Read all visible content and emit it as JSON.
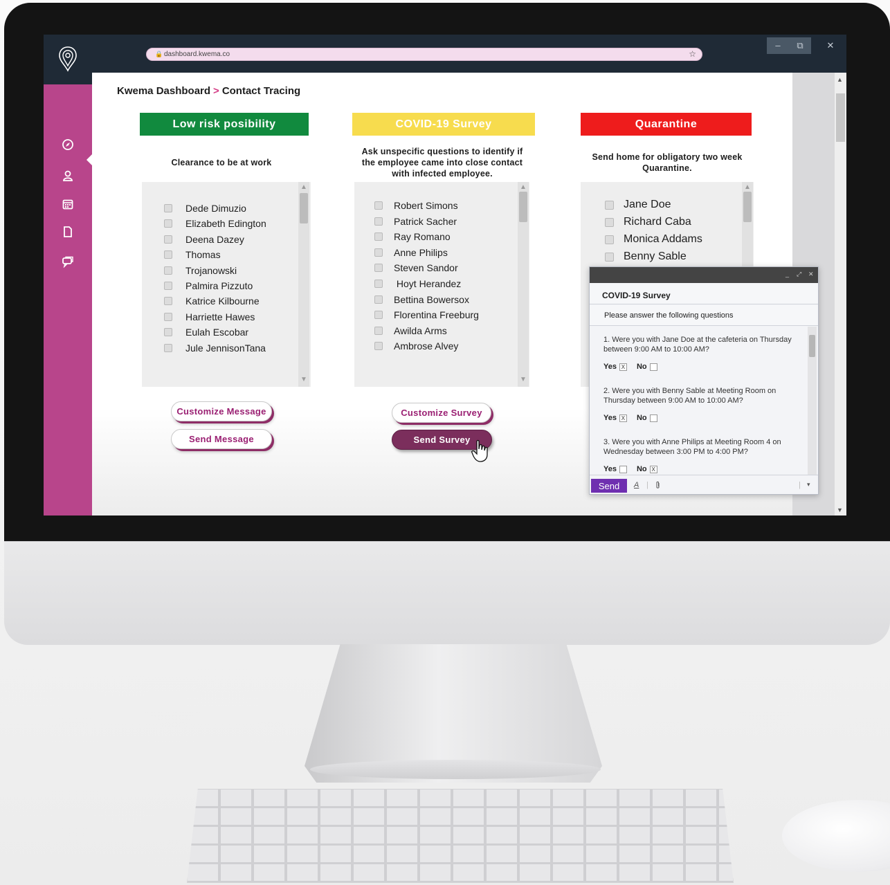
{
  "browser": {
    "url": "dashboard.kwema.co",
    "window_controls": {
      "minimize": "–",
      "restore": "⧉",
      "close": "✕"
    }
  },
  "sidebar": {
    "icons": [
      "compass-icon",
      "user-icon",
      "calendar-icon",
      "document-icon",
      "chat-icon"
    ]
  },
  "breadcrumb": {
    "root": "Kwema Dashboard",
    "separator": ">",
    "current": "Contact Tracing"
  },
  "columns": {
    "low_risk": {
      "title": "Low risk posibility",
      "color": "#118a3e",
      "description": "Clearance to be at work",
      "people": [
        "Dede Dimuzio",
        "Elizabeth Edington",
        "Deena Dazey",
        "Thomas",
        "Trojanowski",
        "Palmira Pizzuto",
        "Katrice Kilbourne",
        "Harriette Hawes",
        "Eulah Escobar",
        "Jule JennisonTana"
      ],
      "buttons": {
        "customize": "Customize Message",
        "send": "Send Message"
      }
    },
    "survey": {
      "title": "COVID-19 Survey",
      "color": "#f7dc4e",
      "description": "Ask unspecific questions to identify if the employee came into close contact with infected employee.",
      "people": [
        "Robert Simons",
        "Patrick Sacher",
        "Ray Romano",
        "Anne Philips",
        "Steven Sandor",
        " Hoyt Herandez",
        "Bettina Bowersox",
        "Florentina Freeburg",
        "Awilda Arms",
        "Ambrose Alvey"
      ],
      "buttons": {
        "customize": "Customize Survey",
        "send": "Send Survey"
      }
    },
    "quarantine": {
      "title": "Quarantine",
      "color": "#ee1c1c",
      "description": "Send home for obligatory two week Quarantine.",
      "people": [
        "Jane Doe",
        "Richard Caba",
        "Monica Addams",
        "Benny Sable"
      ]
    }
  },
  "popup": {
    "controls": {
      "minimize": "_",
      "expand": "⤢",
      "close": "✕"
    },
    "subject": "COVID-19 Survey",
    "intro": "Please answer the following questions",
    "yes_label": "Yes",
    "no_label": "No",
    "questions": [
      {
        "text": "1. Were you with Jane Doe at the cafeteria on Thursday between 9:00 AM to 10:00 AM?",
        "yes": "X",
        "no": ""
      },
      {
        "text": "2. Were you with Benny Sable at Meeting Room on Thursday  between 9:00 AM to 10:00 AM?",
        "yes": "X",
        "no": ""
      },
      {
        "text": "3. Were you with Anne Philips at Meeting Room 4 on Wednesday between 3:00 PM to 4:00 PM?",
        "yes": "",
        "no": "X"
      }
    ],
    "send_label": "Send",
    "format_icon": "A",
    "attach_icon": "paperclip-icon",
    "more_icon": "▾"
  },
  "colors": {
    "sidebar": "#b8458b",
    "topbar": "#1f2a36",
    "accent": "#9a1f72",
    "send": "#6f2fb0"
  }
}
